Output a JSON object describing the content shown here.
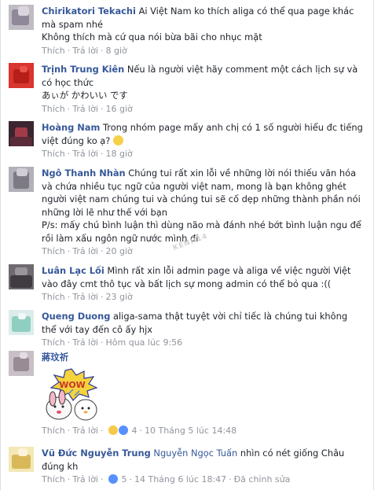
{
  "comments": [
    {
      "name": "Chirikatori Tekachi",
      "text_lines": [
        "Ai Việt Nam ko thích aliga có thể qua page khác mà spam nhé",
        "Không thích mà cứ qua nói bừa bãi cho nhục mặt"
      ],
      "like": "Thích",
      "reply": "Trả lời",
      "time": "8 giờ"
    },
    {
      "name": "Trịnh Trung Kiên",
      "text_lines": [
        "Nếu là người việt hãy comment một cách lịch sự và có học thức",
        "あぃが かわいい です"
      ],
      "like": "Thích",
      "reply": "Trả lời",
      "time": "16 giờ"
    },
    {
      "name": "Hoàng Nam",
      "text_lines": [
        "Trong nhóm page mấy anh chị có 1 số người hiểu đc tiếng việt đúng ko ạ?"
      ],
      "like": "Thích",
      "reply": "Trả lời",
      "time": "18 giờ"
    },
    {
      "name": "Ngô Thanh Nhàn",
      "text_lines": [
        "Chúng tui rất xin lỗi về những lời nói thiếu văn hóa và chứa nhiều tục ngữ của người việt nam, mong là bạn không ghét người việt nam chúng tui và chúng tui sẽ cố dẹp những thành phần nói những lời lẽ như thế với bạn",
        "P/s: mấy chú bình luận thì dùng não mà đánh nhé bớt bình luận ngu để rồi làm xấu ngôn ngữ nước mình đi"
      ],
      "like": "Thích",
      "reply": "Trả lời",
      "time": "20 giờ"
    },
    {
      "name": "Luân Lạc Lối",
      "text_lines": [
        "Mình rất xin lỗi admin page và aliga về việc người Việt vào đây cmt thô tục và bất lịch sự mong admin có thể bỏ qua :(("
      ],
      "like": "Thích",
      "reply": "Trả lời",
      "time": "23 giờ"
    },
    {
      "name": "Queng Duong",
      "text_lines": [
        "aliga-sama thật tuyệt vời chỉ tiếc là chúng tui không thể với tay đến cô ấy hjx"
      ],
      "like": "Thích",
      "reply": "Trả lời",
      "time": "Hôm qua lúc 9:56"
    },
    {
      "name": "蔣玟祈",
      "sticker": "WOW",
      "like": "Thích",
      "reply": "Trả lời",
      "reactions": "4",
      "time": "10 Tháng 5 lúc 14:48"
    },
    {
      "name": "Vũ Đức Nguyễn Trung",
      "tag": "Nguyễn Ngọc Tuấn",
      "text_lines": [
        "nhìn có nét giống Châu đúng kh"
      ],
      "like": "Thích",
      "reply": "Trả lời",
      "reactions": "5",
      "time": "14 Tháng 6 lúc 18:47",
      "edited": "Đã chỉnh sửa"
    }
  ],
  "watermark": "KENH14",
  "colors": {
    "name": "#365899",
    "meta": "#90949c",
    "text": "#1d2129"
  }
}
